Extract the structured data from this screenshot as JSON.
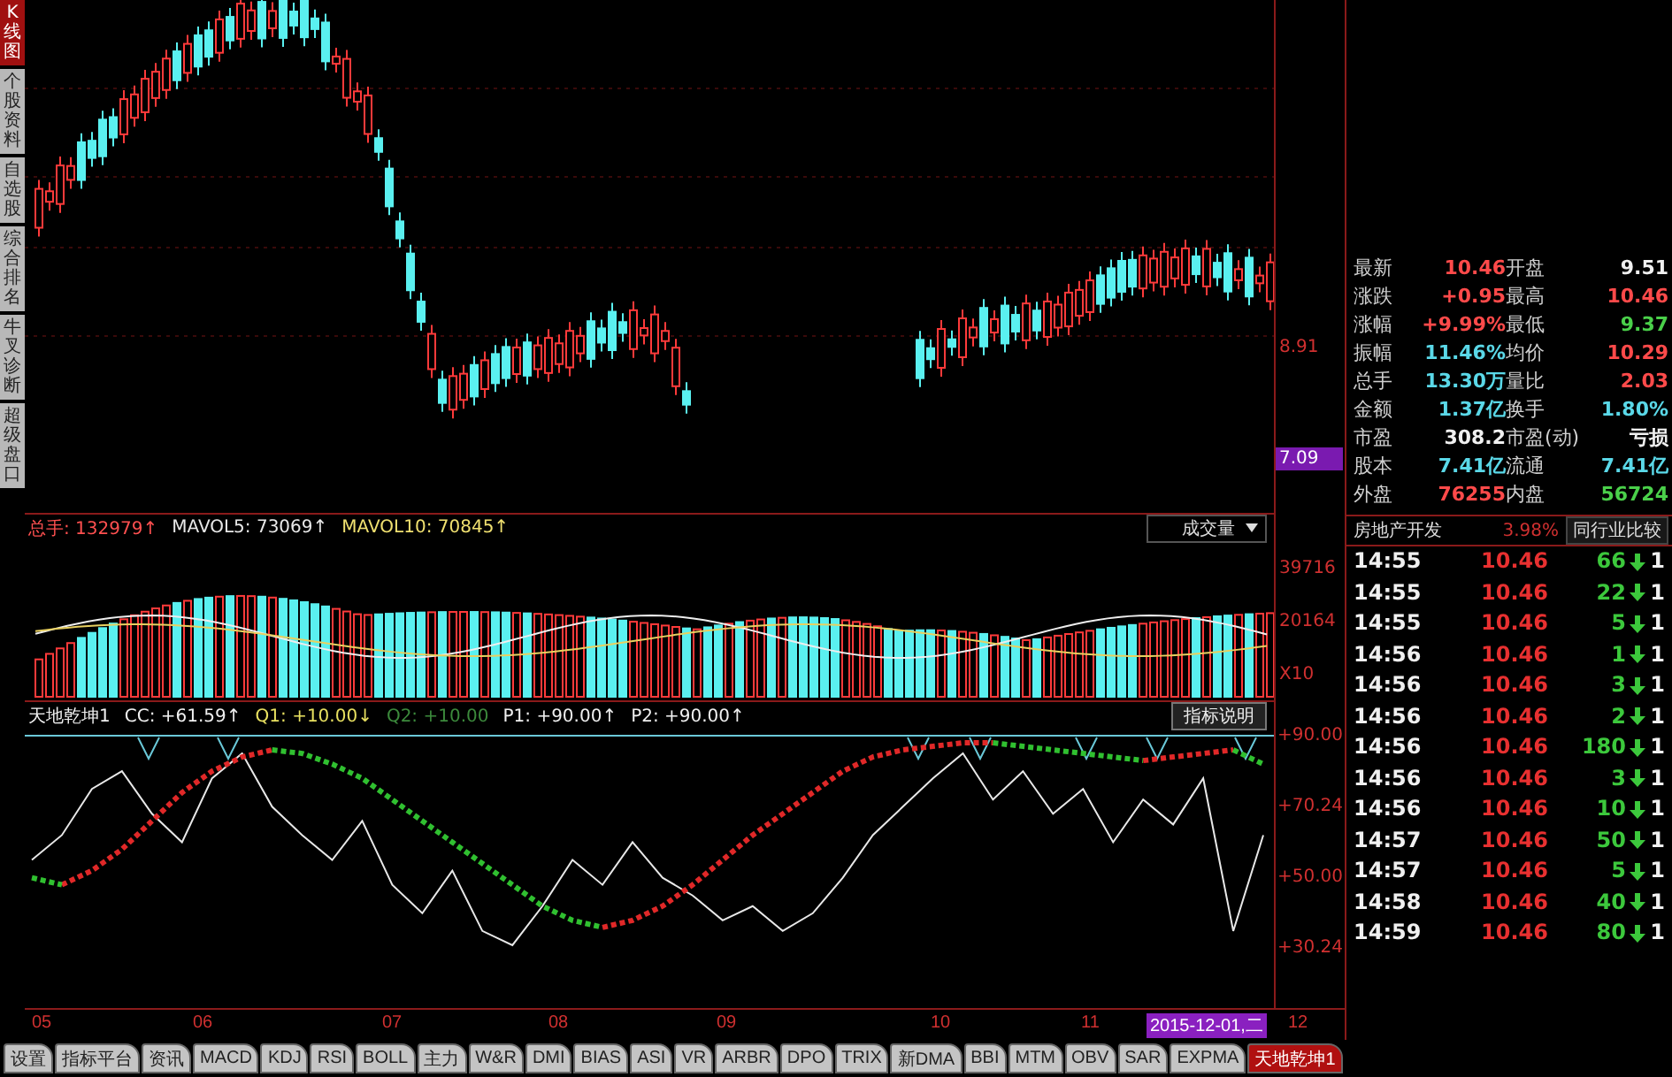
{
  "sidebar": {
    "items": [
      {
        "label": "K线图",
        "selected": true
      },
      {
        "label": "个股资料",
        "selected": false
      },
      {
        "label": "自选股",
        "selected": false
      },
      {
        "label": "综合排名",
        "selected": false
      },
      {
        "label": "牛叉诊断",
        "selected": false
      },
      {
        "label": "超级盘口",
        "selected": false
      }
    ]
  },
  "price_axis": {
    "labels": [
      {
        "text": "8.91",
        "highlighted": false
      },
      {
        "text": "7.09",
        "highlighted": true
      }
    ]
  },
  "volume": {
    "header": [
      {
        "text": "总手: 132979↑",
        "color": "#ff5050"
      },
      {
        "text": "MAVOL5: 73069↑",
        "color": "#e8e8e8"
      },
      {
        "text": "MAVOL10: 70845↑",
        "color": "#f0e070"
      }
    ],
    "dropdown": "成交量",
    "axis": [
      "39716",
      "20164",
      "X10"
    ]
  },
  "indicator": {
    "header": [
      {
        "text": "天地乾坤1",
        "color": "#f0f0f0"
      },
      {
        "text": "CC: +61.59↑",
        "color": "#f0f0f0"
      },
      {
        "text": "Q1: +10.00↓",
        "color": "#e8e060"
      },
      {
        "text": "Q2: +10.00",
        "color": "#3c8a3c"
      },
      {
        "text": "P1: +90.00↑",
        "color": "#f0f0f0"
      },
      {
        "text": "P2: +90.00↑",
        "color": "#f0f0f0"
      }
    ],
    "button": "指标说明",
    "chart_data": {
      "type": "line",
      "ylim": [
        13.3,
        90
      ],
      "yticks": [
        {
          "value": 90,
          "label": "+90.00"
        },
        {
          "value": 70.24,
          "label": "+70.24"
        },
        {
          "value": 50,
          "label": "+50.00"
        },
        {
          "value": 30.24,
          "label": "+30.24"
        }
      ],
      "series": [
        {
          "color": "#e8e8e8",
          "values": [
            55,
            62,
            75,
            80,
            68,
            60,
            78,
            85,
            70,
            62,
            55,
            66,
            48,
            40,
            52,
            35,
            31,
            42,
            55,
            48,
            60,
            50,
            45,
            38,
            42,
            35,
            40,
            50,
            62,
            70,
            78,
            85,
            72,
            80,
            68,
            75,
            60,
            72,
            65,
            78,
            35,
            62
          ]
        },
        {
          "color": "#e02828",
          "line_style": "dashed",
          "values": [
            null,
            48,
            52,
            58,
            66,
            74,
            80,
            84,
            86,
            null,
            null,
            null,
            null,
            null,
            null,
            null,
            null,
            null,
            null,
            36,
            38,
            42,
            48,
            55,
            62,
            68,
            74,
            80,
            84,
            86,
            87,
            88,
            88,
            null,
            null,
            null,
            null,
            83,
            84,
            85,
            86,
            null
          ]
        },
        {
          "color": "#30c030",
          "line_style": "dashed",
          "values": [
            50,
            48,
            null,
            null,
            null,
            null,
            null,
            null,
            86,
            85,
            82,
            78,
            72,
            66,
            60,
            54,
            48,
            42,
            38,
            36,
            null,
            null,
            null,
            null,
            null,
            null,
            null,
            null,
            null,
            null,
            null,
            null,
            88,
            87,
            86,
            85,
            84,
            83,
            null,
            null,
            86,
            82
          ]
        }
      ]
    }
  },
  "date_axis": [
    {
      "text": "05",
      "highlighted": false
    },
    {
      "text": "06",
      "highlighted": false
    },
    {
      "text": "07",
      "highlighted": false
    },
    {
      "text": "08",
      "highlighted": false
    },
    {
      "text": "09",
      "highlighted": false
    },
    {
      "text": "10",
      "highlighted": false
    },
    {
      "text": "11",
      "highlighted": false
    },
    {
      "text": "2015-12-01,二",
      "highlighted": true
    },
    {
      "text": "12",
      "highlighted": false
    }
  ],
  "quote": {
    "rows": [
      {
        "cells": [
          {
            "label": "最新",
            "value": "10.46",
            "color": "#ff4a4a"
          },
          {
            "label": "开盘",
            "value": "9.51",
            "color": "#f0f0f0"
          }
        ]
      },
      {
        "cells": [
          {
            "label": "涨跌",
            "value": "+0.95",
            "color": "#ff4a4a"
          },
          {
            "label": "最高",
            "value": "10.46",
            "color": "#ff4a4a"
          }
        ]
      },
      {
        "cells": [
          {
            "label": "涨幅",
            "value": "+9.99%",
            "color": "#ff4a4a"
          },
          {
            "label": "最低",
            "value": "9.37",
            "color": "#4ad04a"
          }
        ]
      },
      {
        "cells": [
          {
            "label": "振幅",
            "value": "11.46%",
            "color": "#5ad8e8"
          },
          {
            "label": "均价",
            "value": "10.29",
            "color": "#ff4a4a"
          }
        ]
      },
      {
        "cells": [
          {
            "label": "总手",
            "value": "13.30万",
            "color": "#5ad8e8"
          },
          {
            "label": "量比",
            "value": "2.03",
            "color": "#ff4a4a"
          }
        ]
      },
      {
        "cells": [
          {
            "label": "金额",
            "value": "1.37亿",
            "color": "#5ad8e8"
          },
          {
            "label": "换手",
            "value": "1.80%",
            "color": "#5ad8e8"
          }
        ]
      },
      {
        "cells": [
          {
            "label": "市盈",
            "value": "308.2",
            "color": "#f0f0f0"
          },
          {
            "label": "市盈(动)",
            "value": "亏损",
            "color": "#f0f0f0"
          }
        ]
      },
      {
        "cells": [
          {
            "label": "股本",
            "value": "7.41亿",
            "color": "#5ad8e8"
          },
          {
            "label": "流通",
            "value": "7.41亿",
            "color": "#5ad8e8"
          }
        ]
      },
      {
        "cells": [
          {
            "label": "外盘",
            "value": "76255",
            "color": "#ff4a4a"
          },
          {
            "label": "内盘",
            "value": "56724",
            "color": "#4ad04a"
          }
        ]
      }
    ],
    "sector": {
      "name": "房地产开发",
      "change": "3.98%",
      "link": "同行业比较"
    }
  },
  "ticks": [
    {
      "time": "14:55",
      "price": "10.46",
      "volume": "66",
      "kind": "sell",
      "column_4": "1"
    },
    {
      "time": "14:55",
      "price": "10.46",
      "volume": "22",
      "kind": "sell",
      "column_4": "1"
    },
    {
      "time": "14:55",
      "price": "10.46",
      "volume": "5",
      "kind": "sell",
      "column_4": "1"
    },
    {
      "time": "14:56",
      "price": "10.46",
      "volume": "1",
      "kind": "sell",
      "column_4": "1"
    },
    {
      "time": "14:56",
      "price": "10.46",
      "volume": "3",
      "kind": "sell",
      "column_4": "1"
    },
    {
      "time": "14:56",
      "price": "10.46",
      "volume": "2",
      "kind": "sell",
      "column_4": "1"
    },
    {
      "time": "14:56",
      "price": "10.46",
      "volume": "180",
      "kind": "sell",
      "column_4": "1"
    },
    {
      "time": "14:56",
      "price": "10.46",
      "volume": "3",
      "kind": "sell",
      "column_4": "1"
    },
    {
      "time": "14:56",
      "price": "10.46",
      "volume": "10",
      "kind": "sell",
      "column_4": "1"
    },
    {
      "time": "14:57",
      "price": "10.46",
      "volume": "50",
      "kind": "sell",
      "column_4": "1"
    },
    {
      "time": "14:57",
      "price": "10.46",
      "volume": "5",
      "kind": "sell",
      "column_4": "1"
    },
    {
      "time": "14:58",
      "price": "10.46",
      "volume": "40",
      "kind": "sell",
      "column_4": "1"
    },
    {
      "time": "14:59",
      "price": "10.46",
      "volume": "80",
      "kind": "sell",
      "column_4": "1"
    }
  ],
  "bottom_tabs": [
    {
      "label": "设置",
      "selected": false
    },
    {
      "label": "指标平台",
      "selected": false
    },
    {
      "label": "资讯",
      "selected": false
    },
    {
      "label": "MACD",
      "selected": false
    },
    {
      "label": "KDJ",
      "selected": false
    },
    {
      "label": "RSI",
      "selected": false
    },
    {
      "label": "BOLL",
      "selected": false
    },
    {
      "label": "主力",
      "selected": false
    },
    {
      "label": "W&R",
      "selected": false
    },
    {
      "label": "DMI",
      "selected": false
    },
    {
      "label": "BIAS",
      "selected": false
    },
    {
      "label": "ASI",
      "selected": false
    },
    {
      "label": "VR",
      "selected": false
    },
    {
      "label": "ARBR",
      "selected": false
    },
    {
      "label": "DPO",
      "selected": false
    },
    {
      "label": "TRIX",
      "selected": false
    },
    {
      "label": "新DMA",
      "selected": false
    },
    {
      "label": "BBI",
      "selected": false
    },
    {
      "label": "MTM",
      "selected": false
    },
    {
      "label": "OBV",
      "selected": false
    },
    {
      "label": "SAR",
      "selected": false
    },
    {
      "label": "EXPMA",
      "selected": false
    },
    {
      "label": "天地乾坤1",
      "selected": true
    }
  ]
}
